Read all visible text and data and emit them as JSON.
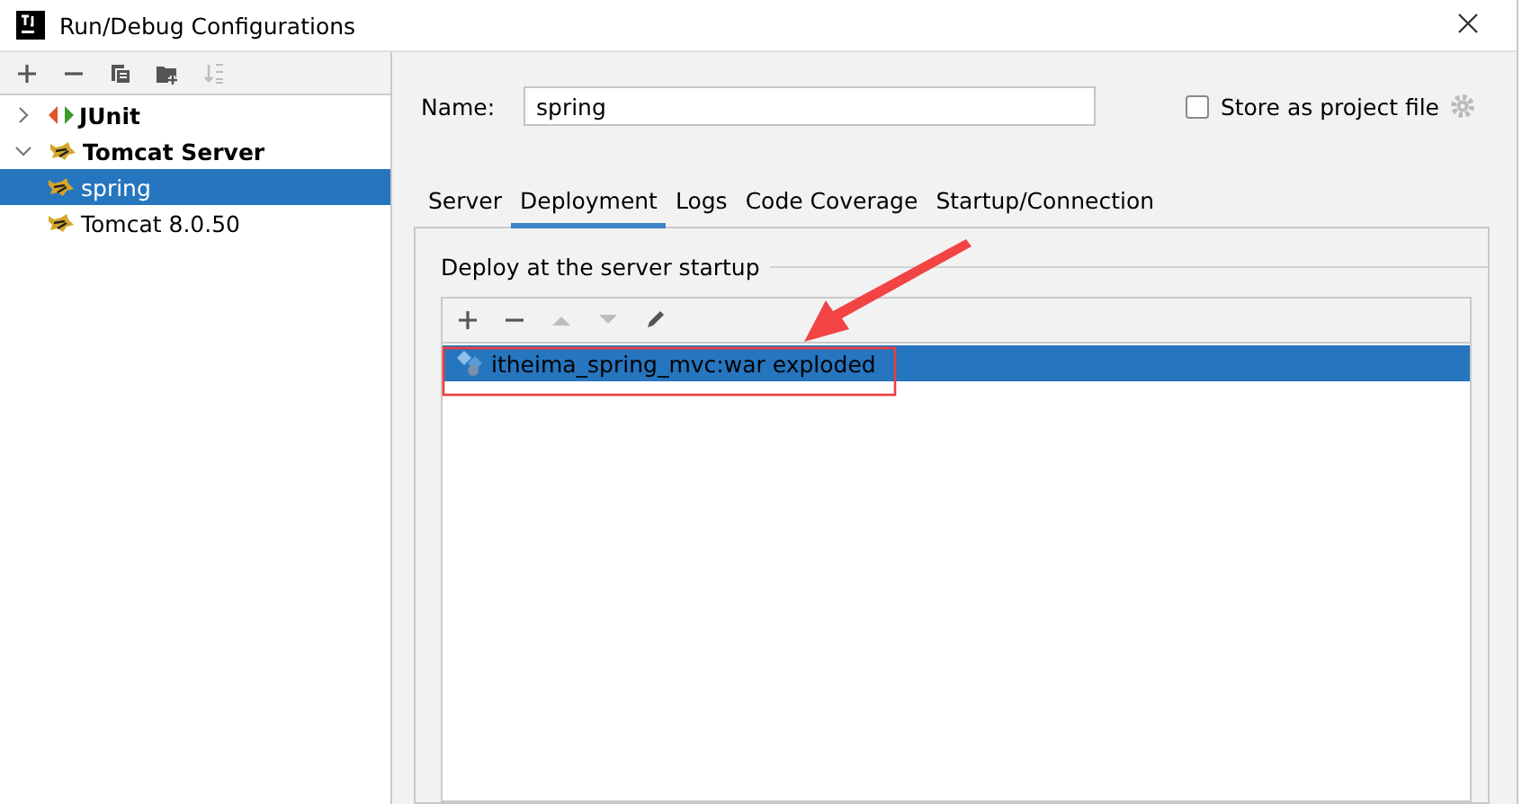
{
  "window": {
    "title": "Run/Debug Configurations"
  },
  "sidebar": {
    "toolbar": [
      {
        "kind": "add",
        "disabled": false
      },
      {
        "kind": "remove",
        "disabled": false
      },
      {
        "kind": "copy",
        "disabled": false
      },
      {
        "kind": "folder",
        "disabled": false
      },
      {
        "kind": "sort",
        "disabled": true
      }
    ],
    "tree": [
      {
        "label": "JUnit",
        "kind": "junit",
        "expanded": false,
        "selected": false
      },
      {
        "label": "Tomcat Server",
        "kind": "tomcat",
        "expanded": true,
        "selected": false,
        "children": [
          {
            "label": "spring",
            "kind": "tomcat",
            "selected": true
          },
          {
            "label": "Tomcat 8.0.50",
            "kind": "tomcat",
            "selected": false
          }
        ]
      }
    ]
  },
  "name_field": {
    "label": "Name:",
    "value": "spring"
  },
  "store_as_project_file": {
    "label": "Store as project file",
    "checked": false
  },
  "tabs": [
    {
      "label": "Server",
      "selected": false
    },
    {
      "label": "Deployment",
      "selected": true
    },
    {
      "label": "Logs",
      "selected": false
    },
    {
      "label": "Code Coverage",
      "selected": false
    },
    {
      "label": "Startup/Connection",
      "selected": false
    }
  ],
  "deployment": {
    "title": "Deploy at the server startup",
    "toolbar": [
      {
        "kind": "add",
        "disabled": false
      },
      {
        "kind": "remove",
        "disabled": false
      },
      {
        "kind": "up",
        "disabled": true
      },
      {
        "kind": "down",
        "disabled": true
      },
      {
        "kind": "edit",
        "disabled": false
      }
    ],
    "artifacts": [
      {
        "label": "itheima_spring_mvc:war exploded",
        "selected": true
      }
    ]
  }
}
